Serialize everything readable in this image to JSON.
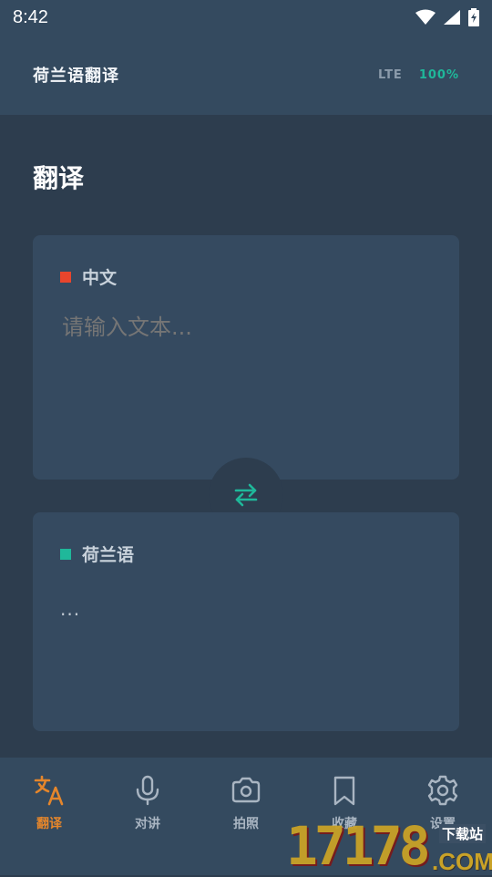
{
  "status_bar": {
    "time": "8:42"
  },
  "app_bar": {
    "title": "荷兰语翻译",
    "network": "LTE",
    "battery": "100%"
  },
  "page": {
    "title": "翻译"
  },
  "source": {
    "language": "中文",
    "placeholder": "请输入文本...",
    "accent": "#e8452c"
  },
  "target": {
    "language": "荷兰语",
    "output": "...",
    "accent": "#1fb89a"
  },
  "swap": {
    "icon": "swap-arrows-icon"
  },
  "nav": {
    "items": [
      {
        "label": "翻译",
        "icon": "translate-icon",
        "active": true
      },
      {
        "label": "对讲",
        "icon": "microphone-icon"
      },
      {
        "label": "拍照",
        "icon": "camera-icon"
      },
      {
        "label": "收藏",
        "icon": "bookmark-icon"
      },
      {
        "label": "设置",
        "icon": "gear-icon"
      }
    ]
  },
  "watermark": {
    "number": "17178",
    "domain": ".COM",
    "site": "下载站"
  },
  "colors": {
    "background": "#2d3d4e",
    "surface": "#354a60",
    "active": "#e5862b",
    "teal": "#1fb89a"
  }
}
